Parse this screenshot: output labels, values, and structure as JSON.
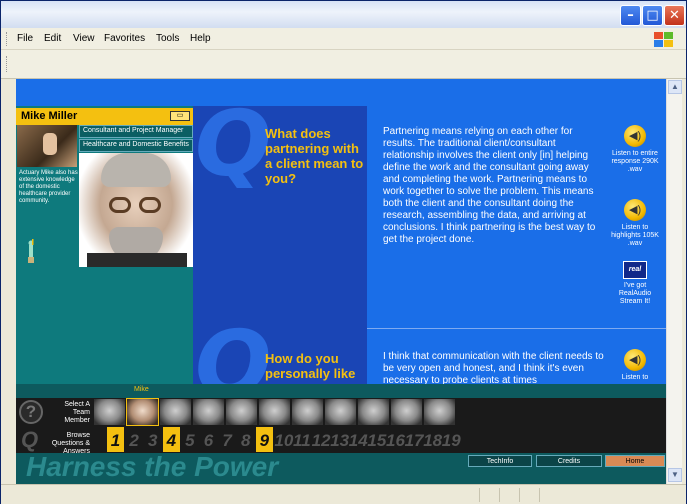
{
  "menu": [
    "File",
    "Edit",
    "View",
    "Favorites",
    "Tools",
    "Help"
  ],
  "window_buttons": {
    "minimize": "–",
    "maximize": "□",
    "close": "✕"
  },
  "profile": {
    "name": "Mike Miller",
    "role": "Consultant and Project Manager",
    "practice": "Healthcare and Domestic Benefits",
    "bio": "Actuary Mike also has extensive knowledge of the domestic healthcare provider community."
  },
  "questions": [
    {
      "question": "What does partnering with a client mean to you?",
      "answer": "Partnering means relying on each other for results. The traditional client/consultant relationship involves the client only [in] helping define the work and the consultant going away and completing the work. Partnering means to work together to solve the problem. This means both the client and the consultant doing the research, assembling the data, and arriving at conclusions. I think partnering is the best way to get the project done."
    },
    {
      "question": "How do you personally like",
      "answer": "I think that communication with the client needs to be very open and honest, and I think it's even necessary to probe clients at times"
    }
  ],
  "audio": {
    "entire": "Listen to entire response 290K .wav",
    "highlights": "Listen to highlights 105K .wav",
    "real": "I've got RealAudio Stream It!",
    "real_logo": "real",
    "second": "Listen to"
  },
  "nav": {
    "selected_member": "Mike",
    "team_label": "Select A Team Member",
    "questions_label": "Browse Questions & Answers",
    "numbers": [
      "1",
      "2",
      "3",
      "4",
      "5",
      "6",
      "7",
      "8",
      "9",
      "10",
      "11",
      "12",
      "13",
      "14",
      "15",
      "16",
      "17",
      "18",
      "19"
    ],
    "visited": [
      1,
      4,
      9
    ]
  },
  "footer": {
    "slogan": "Harness the Power",
    "techinfo": "TechInfo",
    "credits": "Credits",
    "home": "Home"
  },
  "colors": {
    "accent_yellow": "#f4c010",
    "page_blue": "#1a6ee8",
    "teal": "#0e7a7d"
  }
}
